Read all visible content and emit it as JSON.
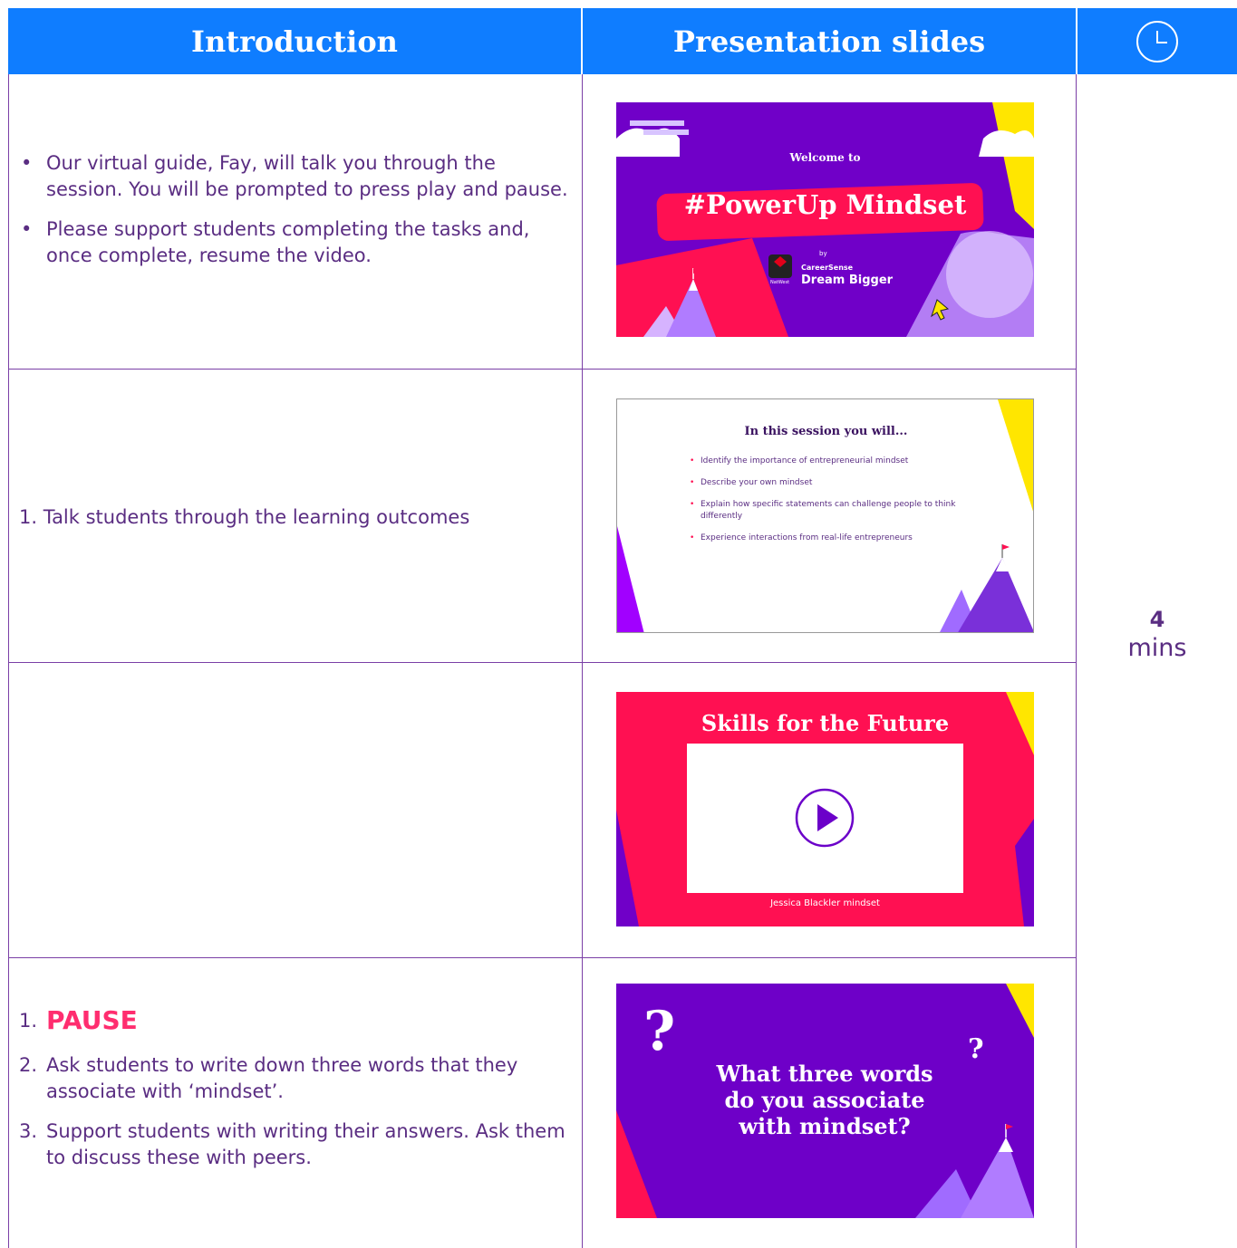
{
  "header": {
    "col1": "Introduction",
    "col2": "Presentation slides",
    "col3_icon": "clock-icon"
  },
  "rows": [
    {
      "bullets": [
        "Our virtual guide, Fay, will talk you through the session. You will be prompted to press play and pause.",
        "Please support students completing the tasks and, once complete, resume the video."
      ],
      "slide": {
        "welcome": "Welcome to",
        "title": "#PowerUp Mindset",
        "by": "by",
        "brand1": "CareerSense",
        "brand2": "Dream Bigger",
        "brand0": "NatWest"
      }
    },
    {
      "items": [
        "1. Talk students through the learning outcomes"
      ],
      "slide": {
        "title": "In this session you will...",
        "bullets": [
          "Identify the importance of entrepreneurial mindset",
          "Describe your own mindset",
          "Explain how specific statements can challenge people to think differently",
          "Experience interactions from real-life entrepreneurs"
        ]
      }
    },
    {
      "slide": {
        "title": "Skills for the Future",
        "caption": "Jessica Blackler mindset"
      }
    },
    {
      "items": [
        {
          "num": "1.",
          "text": "PAUSE"
        },
        {
          "num": "2.",
          "text": "Ask students to write down three words that they associate with ‘mindset’."
        },
        {
          "num": "3.",
          "text": "Support students with writing their answers. Ask them to discuss these with peers."
        }
      ],
      "slide": {
        "title": "What three words do you associate with mindset?",
        "q1": "?",
        "q2": "?"
      }
    }
  ],
  "time": {
    "value": "4",
    "unit": "mins"
  },
  "colors": {
    "header": "#0f7dff",
    "text": "#5a2d82",
    "accent": "#ff2d6f",
    "purple": "#6b00c9",
    "red": "#ff1052",
    "yellow": "#ffe600"
  }
}
